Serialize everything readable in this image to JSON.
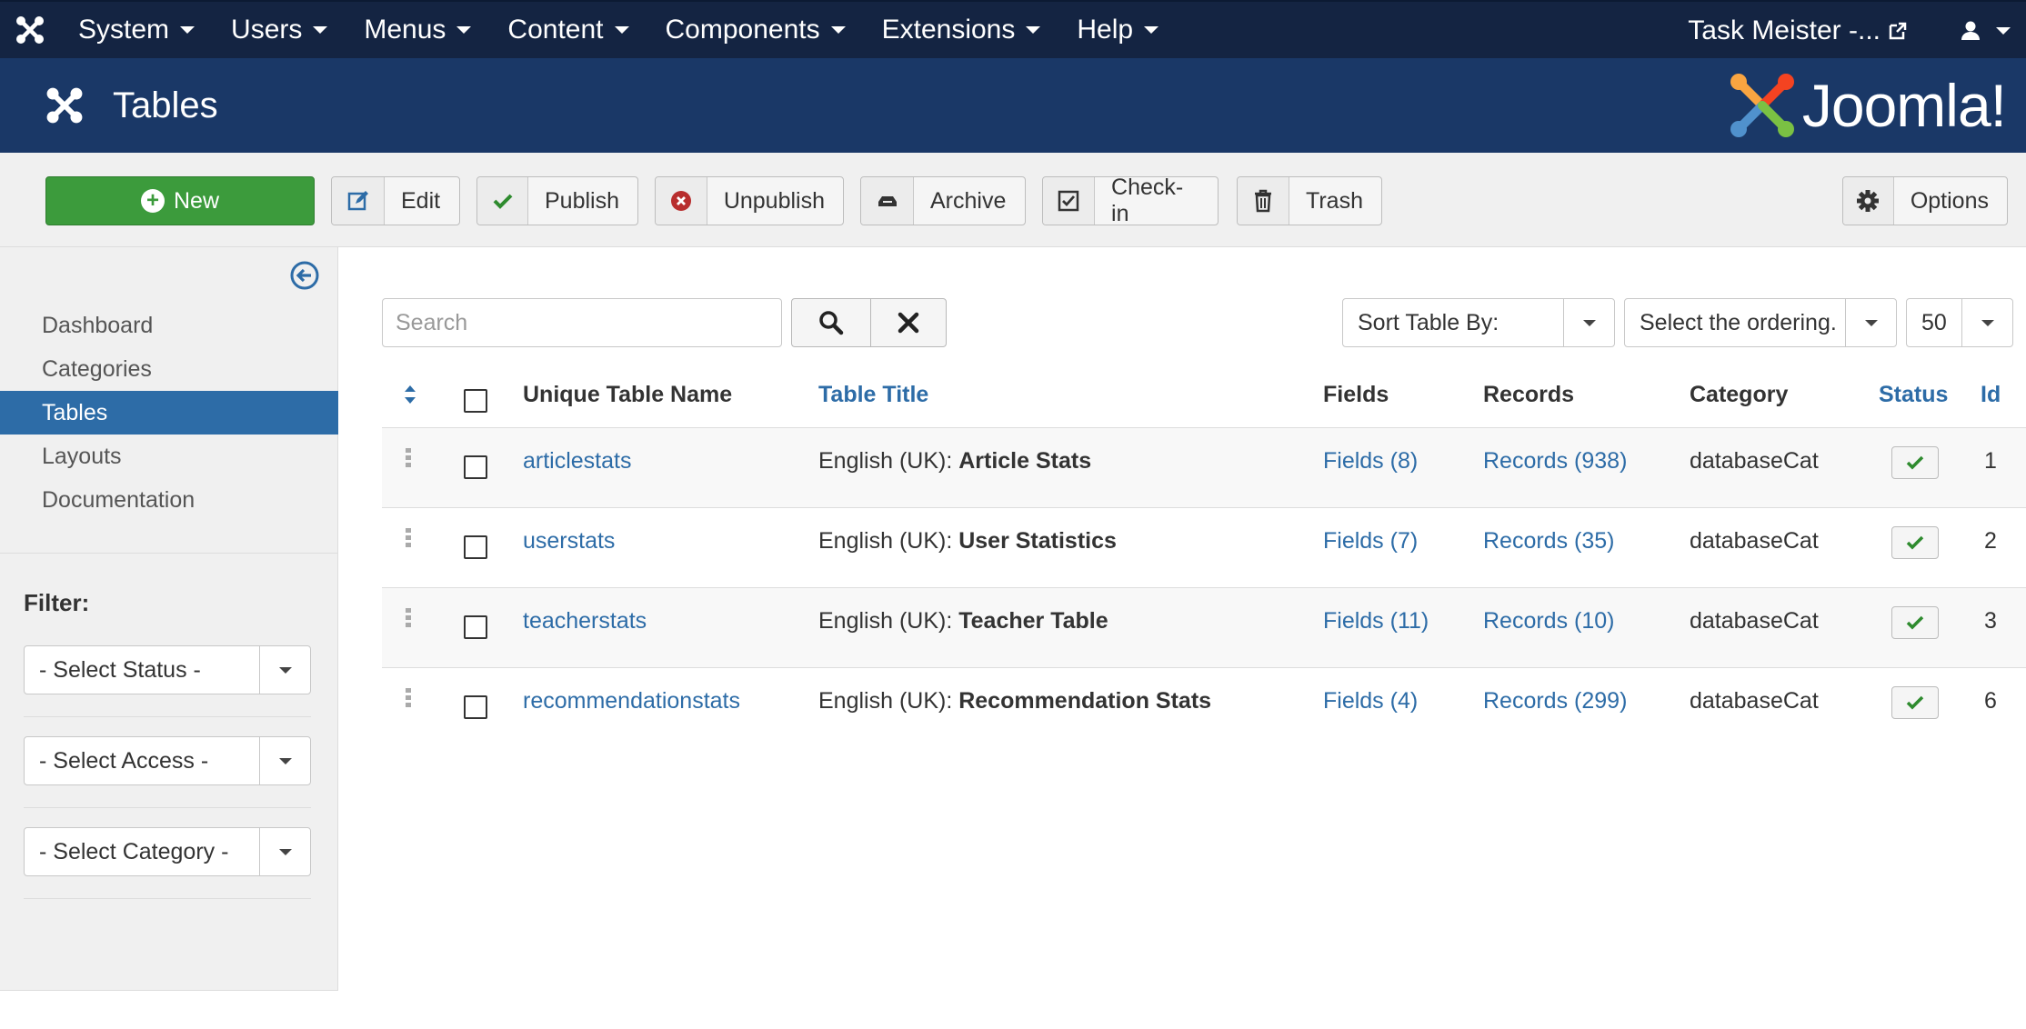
{
  "nav": {
    "items": [
      "System",
      "Users",
      "Menus",
      "Content",
      "Components",
      "Extensions",
      "Help"
    ],
    "site_name": "Task Meister -..."
  },
  "header": {
    "title": "Tables",
    "brand": "Joomla!"
  },
  "toolbar": {
    "new": "New",
    "edit": "Edit",
    "publish": "Publish",
    "unpublish": "Unpublish",
    "archive": "Archive",
    "checkin": "Check-in",
    "trash": "Trash",
    "options": "Options"
  },
  "sidebar": {
    "items": [
      "Dashboard",
      "Categories",
      "Tables",
      "Layouts",
      "Documentation"
    ],
    "active": "Tables",
    "filter_label": "Filter:",
    "filters": [
      "- Select Status -",
      "- Select Access -",
      "- Select Category -"
    ]
  },
  "search": {
    "placeholder": "Search"
  },
  "sort": {
    "by": "Sort Table By:",
    "ordering": "Select the ordering.",
    "limit": "50"
  },
  "table": {
    "headers": {
      "name": "Unique Table Name",
      "title": "Table Title",
      "fields": "Fields",
      "records": "Records",
      "category": "Category",
      "status": "Status",
      "id": "Id"
    },
    "rows": [
      {
        "name": "articlestats",
        "lang": "English (UK):",
        "title": "Article Stats",
        "fields": "Fields (8)",
        "records": "Records (938)",
        "category": "databaseCat",
        "id": "1"
      },
      {
        "name": "userstats",
        "lang": "English (UK):",
        "title": "User Statistics",
        "fields": "Fields (7)",
        "records": "Records (35)",
        "category": "databaseCat",
        "id": "2"
      },
      {
        "name": "teacherstats",
        "lang": "English (UK):",
        "title": "Teacher Table",
        "fields": "Fields (11)",
        "records": "Records (10)",
        "category": "databaseCat",
        "id": "3"
      },
      {
        "name": "recommendationstats",
        "lang": "English (UK):",
        "title": "Recommendation Stats",
        "fields": "Fields (4)",
        "records": "Records (299)",
        "category": "databaseCat",
        "id": "6"
      }
    ]
  },
  "colors": {
    "navbar": "#142442",
    "header": "#1a3867",
    "accent": "#2d6ca7",
    "new_button": "#3c9b3c",
    "published": "#2e8b2e"
  }
}
